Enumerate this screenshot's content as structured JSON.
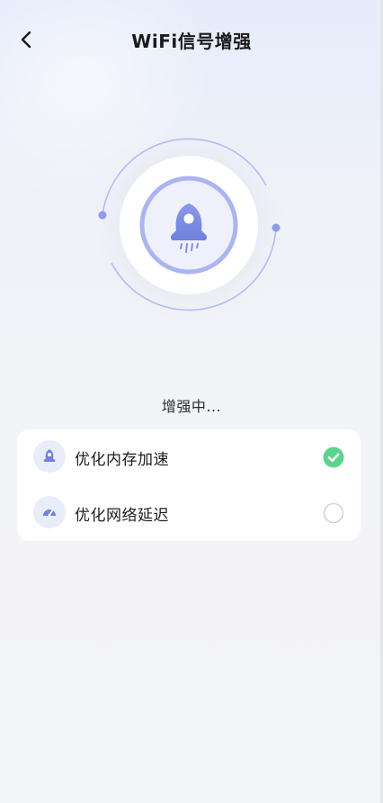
{
  "header": {
    "title": "WiFi信号增强",
    "back_icon": "chevron-left-icon"
  },
  "hero": {
    "icon": "rocket-icon",
    "accent_color": "#7f8ee6",
    "ring_color": "#aab5f0"
  },
  "status": {
    "text": "增强中..."
  },
  "tasks": [
    {
      "label": "优化内存加速",
      "icon": "rocket-icon",
      "state": "done",
      "state_icon": "check-circle-icon"
    },
    {
      "label": "优化网络延迟",
      "icon": "speedometer-icon",
      "state": "pending",
      "state_icon": "empty-circle-icon"
    }
  ],
  "colors": {
    "check_green": "#5bd38c",
    "icon_blue": "#7283e0"
  }
}
